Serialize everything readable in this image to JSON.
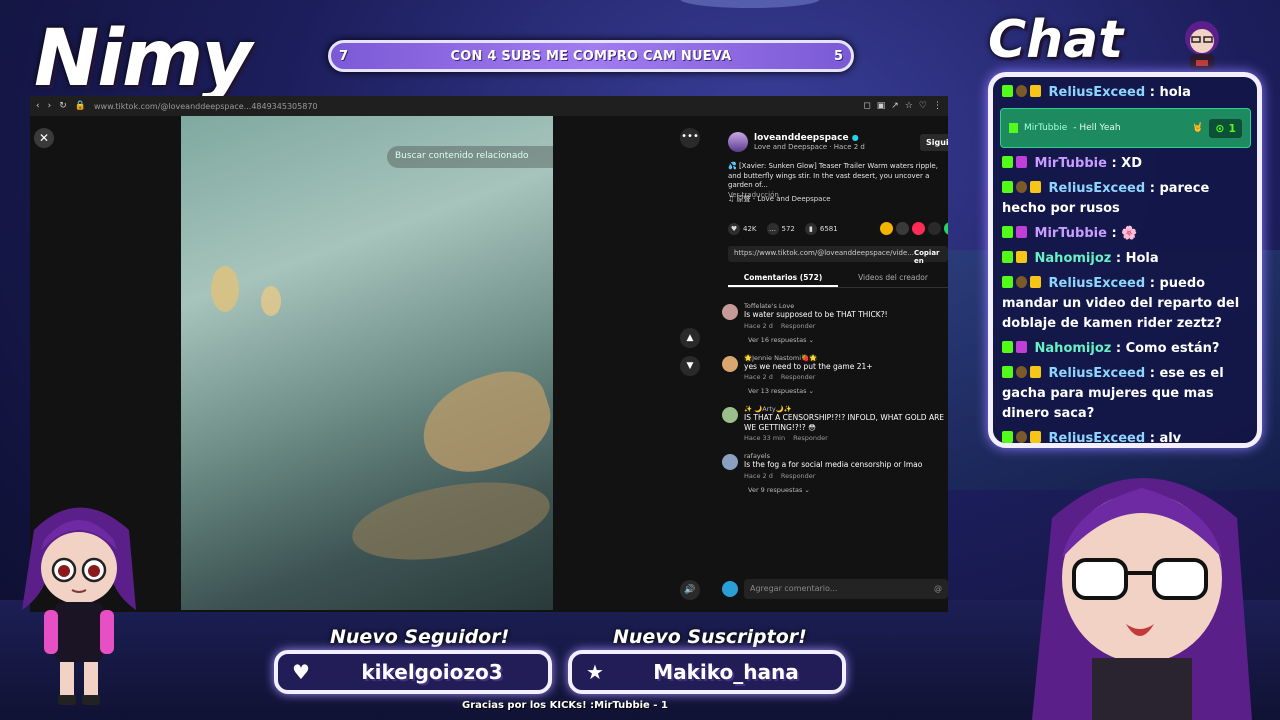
{
  "overlay": {
    "streamer_name": "Nimy",
    "chat_title": "Chat",
    "goal": {
      "left_count": "7",
      "text": "CON 4 SUBS ME COMPRO CAM NUEVA",
      "right_count": "5"
    },
    "new_follower_label": "Nuevo Seguidor!",
    "new_follower_name": "kikelgoiozo3",
    "new_sub_label": "Nuevo Suscriptor!",
    "new_sub_name": "Makiko_hana",
    "footer": "Gracias por los KICKs! :MirTubbie - 1"
  },
  "browser": {
    "url": "www.tiktok.com/@loveanddeepspace...4849345305870",
    "search_placeholder": "Buscar contenido relacionado",
    "author": {
      "username": "loveanddeepspace",
      "subtitle": "Love and Deepspace · Hace 2 d",
      "follow": "Siguie"
    },
    "description": "💦 [Xavier: Sunken Glow] Teaser Trailer Warm waters ripple, and butterfly wings stir. In the vast desert, you uncover a garden of...",
    "see_translation": "Ver traducción",
    "music": "原聲 - Love and Deepspace",
    "stats": {
      "likes": "42K",
      "comments": "572",
      "saves": "6581"
    },
    "link": "https://www.tiktok.com/@loveanddeepspace/vide...",
    "copy": "Copiar en",
    "tabs": [
      "Comentarios (572)",
      "Videos del creador"
    ],
    "comments": [
      {
        "user": "Toffelate's Love",
        "text": "Is water supposed to be THAT THICK?!",
        "time": "Hace 2 d",
        "reply": "Responder",
        "replies": "Ver 16 respuestas ⌄"
      },
      {
        "user": "🌟Jennie Nastomi🍓🌟",
        "text": "yes we need to put the game 21+",
        "time": "Hace 2 d",
        "reply": "Responder",
        "replies": "Ver 13 respuestas ⌄"
      },
      {
        "user": "✨ 🌙Arty🌙✨",
        "text": "IS THAT A CENSORSHIP!?!? INFOLD, WHAT GOLD ARE WE GETTING!?!? 😳",
        "time": "Hace 33 min",
        "reply": "Responder",
        "replies": ""
      },
      {
        "user": "rafayels",
        "text": "Is the fog a for social media censorship or lmao",
        "time": "Hace 2 d",
        "reply": "Responder",
        "replies": "Ver 9 respuestas ⌄"
      }
    ],
    "add_comment_placeholder": "Agregar comentario...",
    "add_comment_at": "@"
  },
  "chat": {
    "messages": [
      {
        "user": "ReliusExceed",
        "text": ": hola",
        "color": "blue",
        "badges": [
          "k",
          "sub",
          "crown"
        ]
      },
      {
        "highlight": true,
        "user": "MirTubbie",
        "text": "- Hell Yeah",
        "amount": "1"
      },
      {
        "user": "MirTubbie",
        "text": ": XD",
        "color": "purple",
        "badges": [
          "k",
          "pink"
        ]
      },
      {
        "user": "ReliusExceed",
        "text": ": parece hecho por rusos",
        "color": "blue",
        "badges": [
          "k",
          "sub",
          "crown"
        ]
      },
      {
        "user": "MirTubbie",
        "text": ": 🌸",
        "color": "purple",
        "badges": [
          "k",
          "pink"
        ]
      },
      {
        "user": "Nahomijoz",
        "text": ": Hola",
        "color": "green",
        "badges": [
          "k",
          "crown"
        ]
      },
      {
        "user": "ReliusExceed",
        "text": ": puedo mandar un video del reparto del doblaje de kamen rider zeztz?",
        "color": "blue",
        "badges": [
          "k",
          "sub",
          "crown"
        ]
      },
      {
        "user": "Nahomijoz",
        "text": ": Como están?",
        "color": "green",
        "badges": [
          "k",
          "pink"
        ]
      },
      {
        "user": "ReliusExceed",
        "text": ": ese es el gacha para mujeres que mas dinero saca?",
        "color": "blue",
        "badges": [
          "k",
          "sub",
          "crown"
        ]
      },
      {
        "user": "ReliusExceed",
        "text": ": alv",
        "color": "blue",
        "badges": [
          "k",
          "sub",
          "crown"
        ]
      }
    ]
  },
  "colors": {
    "accent": "#a17bf0",
    "kick_green": "#53fc18",
    "chat_border": "#f4efff"
  }
}
